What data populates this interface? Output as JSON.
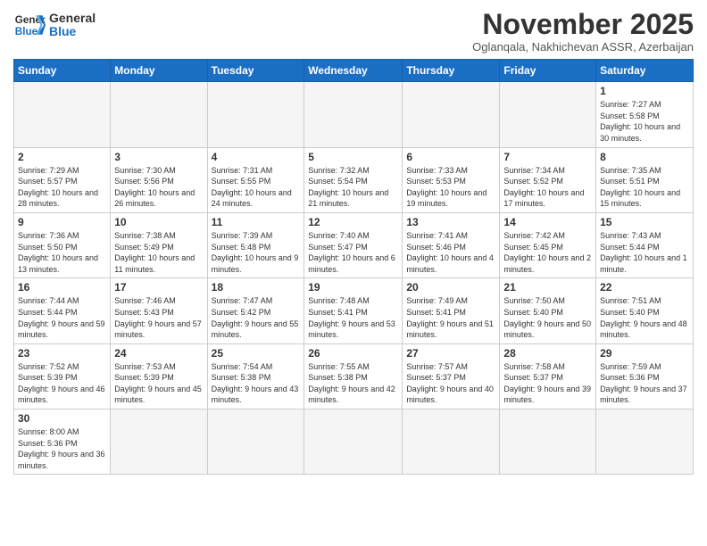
{
  "header": {
    "logo_general": "General",
    "logo_blue": "Blue",
    "month_title": "November 2025",
    "location": "Oglanqala, Nakhichevan ASSR, Azerbaijan"
  },
  "weekdays": [
    "Sunday",
    "Monday",
    "Tuesday",
    "Wednesday",
    "Thursday",
    "Friday",
    "Saturday"
  ],
  "weeks": [
    [
      {
        "day": "",
        "info": ""
      },
      {
        "day": "",
        "info": ""
      },
      {
        "day": "",
        "info": ""
      },
      {
        "day": "",
        "info": ""
      },
      {
        "day": "",
        "info": ""
      },
      {
        "day": "",
        "info": ""
      },
      {
        "day": "1",
        "info": "Sunrise: 7:27 AM\nSunset: 5:58 PM\nDaylight: 10 hours\nand 30 minutes."
      }
    ],
    [
      {
        "day": "2",
        "info": "Sunrise: 7:29 AM\nSunset: 5:57 PM\nDaylight: 10 hours\nand 28 minutes."
      },
      {
        "day": "3",
        "info": "Sunrise: 7:30 AM\nSunset: 5:56 PM\nDaylight: 10 hours\nand 26 minutes."
      },
      {
        "day": "4",
        "info": "Sunrise: 7:31 AM\nSunset: 5:55 PM\nDaylight: 10 hours\nand 24 minutes."
      },
      {
        "day": "5",
        "info": "Sunrise: 7:32 AM\nSunset: 5:54 PM\nDaylight: 10 hours\nand 21 minutes."
      },
      {
        "day": "6",
        "info": "Sunrise: 7:33 AM\nSunset: 5:53 PM\nDaylight: 10 hours\nand 19 minutes."
      },
      {
        "day": "7",
        "info": "Sunrise: 7:34 AM\nSunset: 5:52 PM\nDaylight: 10 hours\nand 17 minutes."
      },
      {
        "day": "8",
        "info": "Sunrise: 7:35 AM\nSunset: 5:51 PM\nDaylight: 10 hours\nand 15 minutes."
      }
    ],
    [
      {
        "day": "9",
        "info": "Sunrise: 7:36 AM\nSunset: 5:50 PM\nDaylight: 10 hours\nand 13 minutes."
      },
      {
        "day": "10",
        "info": "Sunrise: 7:38 AM\nSunset: 5:49 PM\nDaylight: 10 hours\nand 11 minutes."
      },
      {
        "day": "11",
        "info": "Sunrise: 7:39 AM\nSunset: 5:48 PM\nDaylight: 10 hours\nand 9 minutes."
      },
      {
        "day": "12",
        "info": "Sunrise: 7:40 AM\nSunset: 5:47 PM\nDaylight: 10 hours\nand 6 minutes."
      },
      {
        "day": "13",
        "info": "Sunrise: 7:41 AM\nSunset: 5:46 PM\nDaylight: 10 hours\nand 4 minutes."
      },
      {
        "day": "14",
        "info": "Sunrise: 7:42 AM\nSunset: 5:45 PM\nDaylight: 10 hours\nand 2 minutes."
      },
      {
        "day": "15",
        "info": "Sunrise: 7:43 AM\nSunset: 5:44 PM\nDaylight: 10 hours\nand 1 minute."
      }
    ],
    [
      {
        "day": "16",
        "info": "Sunrise: 7:44 AM\nSunset: 5:44 PM\nDaylight: 9 hours\nand 59 minutes."
      },
      {
        "day": "17",
        "info": "Sunrise: 7:46 AM\nSunset: 5:43 PM\nDaylight: 9 hours\nand 57 minutes."
      },
      {
        "day": "18",
        "info": "Sunrise: 7:47 AM\nSunset: 5:42 PM\nDaylight: 9 hours\nand 55 minutes."
      },
      {
        "day": "19",
        "info": "Sunrise: 7:48 AM\nSunset: 5:41 PM\nDaylight: 9 hours\nand 53 minutes."
      },
      {
        "day": "20",
        "info": "Sunrise: 7:49 AM\nSunset: 5:41 PM\nDaylight: 9 hours\nand 51 minutes."
      },
      {
        "day": "21",
        "info": "Sunrise: 7:50 AM\nSunset: 5:40 PM\nDaylight: 9 hours\nand 50 minutes."
      },
      {
        "day": "22",
        "info": "Sunrise: 7:51 AM\nSunset: 5:40 PM\nDaylight: 9 hours\nand 48 minutes."
      }
    ],
    [
      {
        "day": "23",
        "info": "Sunrise: 7:52 AM\nSunset: 5:39 PM\nDaylight: 9 hours\nand 46 minutes."
      },
      {
        "day": "24",
        "info": "Sunrise: 7:53 AM\nSunset: 5:39 PM\nDaylight: 9 hours\nand 45 minutes."
      },
      {
        "day": "25",
        "info": "Sunrise: 7:54 AM\nSunset: 5:38 PM\nDaylight: 9 hours\nand 43 minutes."
      },
      {
        "day": "26",
        "info": "Sunrise: 7:55 AM\nSunset: 5:38 PM\nDaylight: 9 hours\nand 42 minutes."
      },
      {
        "day": "27",
        "info": "Sunrise: 7:57 AM\nSunset: 5:37 PM\nDaylight: 9 hours\nand 40 minutes."
      },
      {
        "day": "28",
        "info": "Sunrise: 7:58 AM\nSunset: 5:37 PM\nDaylight: 9 hours\nand 39 minutes."
      },
      {
        "day": "29",
        "info": "Sunrise: 7:59 AM\nSunset: 5:36 PM\nDaylight: 9 hours\nand 37 minutes."
      }
    ],
    [
      {
        "day": "30",
        "info": "Sunrise: 8:00 AM\nSunset: 5:36 PM\nDaylight: 9 hours\nand 36 minutes."
      },
      {
        "day": "",
        "info": ""
      },
      {
        "day": "",
        "info": ""
      },
      {
        "day": "",
        "info": ""
      },
      {
        "day": "",
        "info": ""
      },
      {
        "day": "",
        "info": ""
      },
      {
        "day": "",
        "info": ""
      }
    ]
  ]
}
